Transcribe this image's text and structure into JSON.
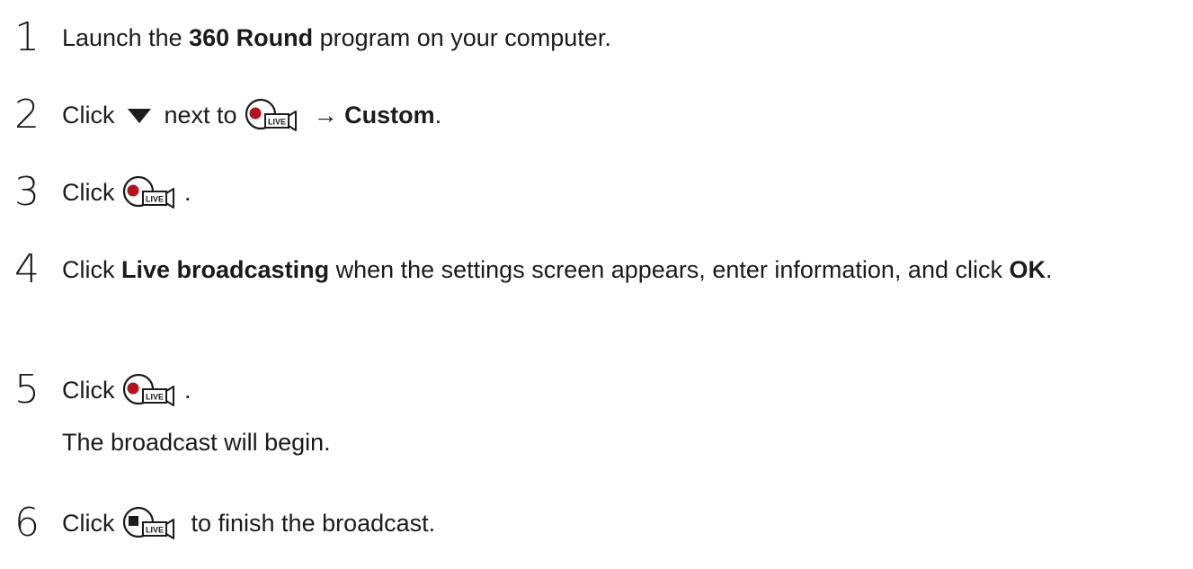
{
  "steps": [
    {
      "number": "1",
      "before": "Launch the ",
      "bold": "360 Round",
      "after": " program on your computer."
    },
    {
      "number": "2",
      "before": "Click ",
      "mid": " next to ",
      "arrow": " → ",
      "bold": "Custom",
      "after": ".",
      "icon_1": "dropdown-triangle-icon",
      "icon_2": "live-record-icon"
    },
    {
      "number": "3",
      "before": "Click ",
      "after": ".",
      "icon": "live-record-icon"
    },
    {
      "number": "4",
      "before": "Click ",
      "bold": "Live broadcasting",
      "after": " when the settings screen appears, enter information, and click ",
      "bold_2": "OK",
      "end": "."
    },
    {
      "number": "5",
      "before": "Click ",
      "after": ".",
      "icon": "live-record-icon",
      "note": "The broadcast will begin."
    },
    {
      "number": "6",
      "before": "Click ",
      "after": " to finish the broadcast.",
      "icon": "live-stop-icon"
    }
  ],
  "icon_labels": {
    "live": "LIVE"
  },
  "colors": {
    "text": "#1b1b1b",
    "record_dot": "#b3121e",
    "icon_stroke": "#1b1b1b"
  }
}
